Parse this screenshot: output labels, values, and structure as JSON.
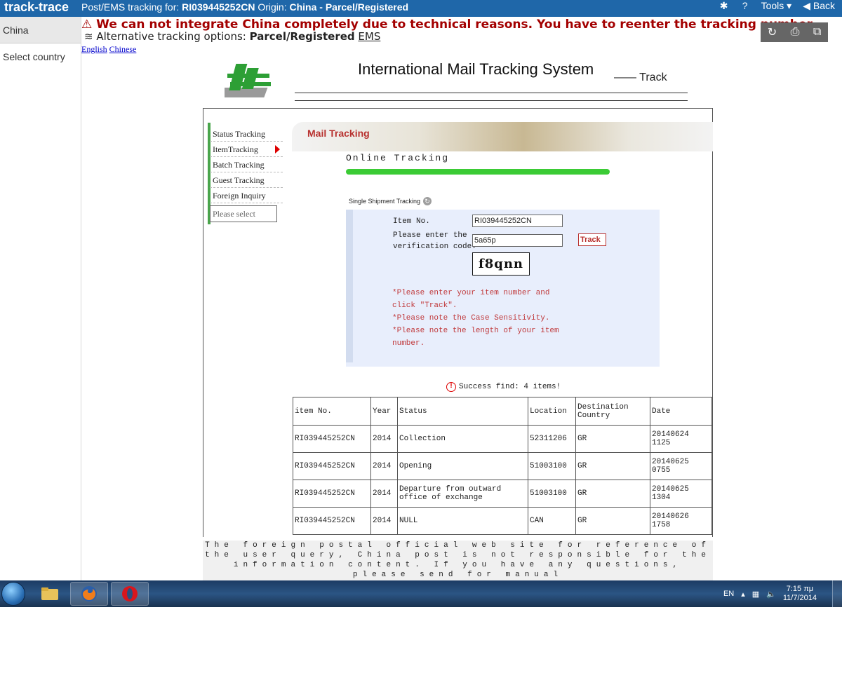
{
  "app": {
    "brand": "track-trace",
    "title_prefix": "Post/EMS tracking for:",
    "tracking_number": "RI039445252CN",
    "origin_label": "Origin:",
    "origin_value": "China - Parcel/Registered"
  },
  "toolbar": {
    "tools_label": "Tools",
    "back_label": "Back"
  },
  "sidebar": {
    "items": [
      {
        "label": "China"
      },
      {
        "label": "Select country"
      }
    ]
  },
  "alert": {
    "warning_text": "We can not integrate China completely due to technical reasons. You have to reenter the tracking number.",
    "alt_prefix": "Alternative tracking options:",
    "alt_option1": "Parcel/Registered",
    "alt_option2": "EMS"
  },
  "lang": {
    "english": "English",
    "chinese": "Chinese"
  },
  "system": {
    "title": "International Mail Tracking System",
    "track_suffix": "—— Track"
  },
  "menu": {
    "items": [
      {
        "label": "Status Tracking"
      },
      {
        "label": "ItemTracking"
      },
      {
        "label": "Batch Tracking"
      },
      {
        "label": "Guest Tracking"
      },
      {
        "label": "Foreign Inquiry"
      }
    ],
    "select_placeholder": "Please select"
  },
  "main": {
    "header": "Mail Tracking",
    "online_tracking": "Online Tracking",
    "single_label": "Single Shipment Tracking"
  },
  "form": {
    "item_label": "Item No.",
    "item_value": "RI039445252CN",
    "verify_label": "Please enter the verification code.",
    "code_value": "5a65p",
    "captcha_text": "f8qnn",
    "track_button": "Track",
    "notes": [
      "*Please enter your item number and click \"Track\".",
      "*Please note the Case Sensitivity.",
      "*Please note the length of your item number."
    ]
  },
  "results": {
    "success_text": "Success find: 4 items!",
    "headers": [
      "item No.",
      "Year",
      "Status",
      "Location",
      "Destination Country",
      "Date"
    ],
    "rows": [
      [
        "RI039445252CN",
        "2014",
        "Collection",
        "52311206",
        "GR",
        "20140624 1125"
      ],
      [
        "RI039445252CN",
        "2014",
        "Opening",
        "51003100",
        "GR",
        "20140625 0755"
      ],
      [
        "RI039445252CN",
        "2014",
        "Departure from outward office of exchange",
        "51003100",
        "GR",
        "20140625 1304"
      ],
      [
        "RI039445252CN",
        "2014",
        "NULL",
        "CAN",
        "GR",
        "20140626 1758"
      ]
    ]
  },
  "footer": {
    "text": "The foreign postal official web site for reference of the user query, China post is not responsible for the information content. If you have any questions, please send for manual"
  },
  "taskbar": {
    "lang": "EN",
    "time": "7:15 πμ",
    "date": "11/7/2014"
  }
}
